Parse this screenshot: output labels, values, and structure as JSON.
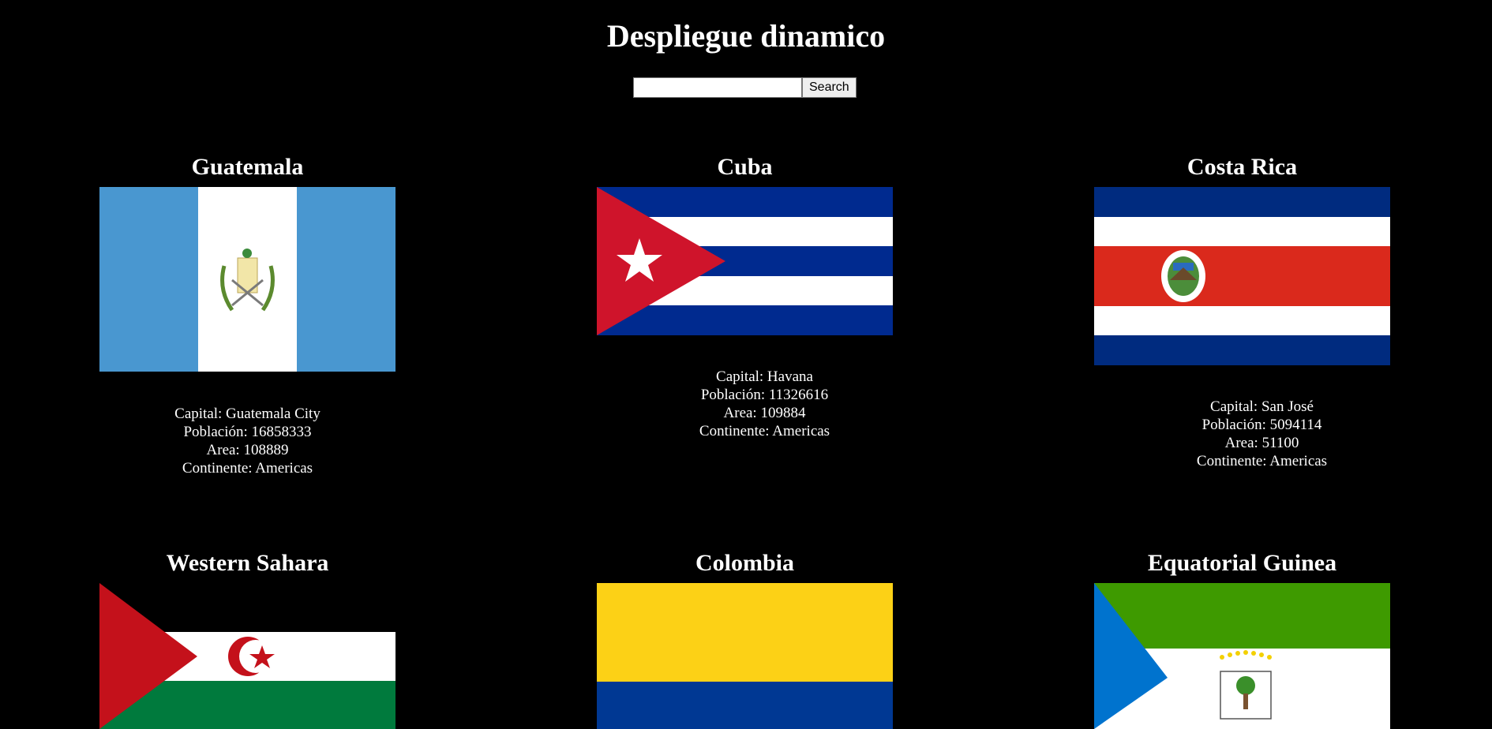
{
  "header": {
    "title": "Despliegue dinamico",
    "search_placeholder": "",
    "search_value": "",
    "search_label": "Search"
  },
  "countries": [
    {
      "name": "Guatemala",
      "flag_icon": "guatemala-flag",
      "capital": "Capital: Guatemala City",
      "population": "Población: 16858333",
      "area": "Area: 108889",
      "continent": "Continente: Americas"
    },
    {
      "name": "Cuba",
      "flag_icon": "cuba-flag",
      "capital": "Capital: Havana",
      "population": "Población: 11326616",
      "area": "Area: 109884",
      "continent": "Continente: Americas"
    },
    {
      "name": "Costa Rica",
      "flag_icon": "costa-rica-flag",
      "capital": "Capital: San José",
      "population": "Población: 5094114",
      "area": "Area: 51100",
      "continent": "Continente: Americas"
    },
    {
      "name": "Western Sahara",
      "flag_icon": "western-sahara-flag"
    },
    {
      "name": "Colombia",
      "flag_icon": "colombia-flag"
    },
    {
      "name": "Equatorial Guinea",
      "flag_icon": "equatorial-guinea-flag"
    }
  ],
  "colors": {
    "background": "#000000",
    "text": "#ffffff"
  }
}
